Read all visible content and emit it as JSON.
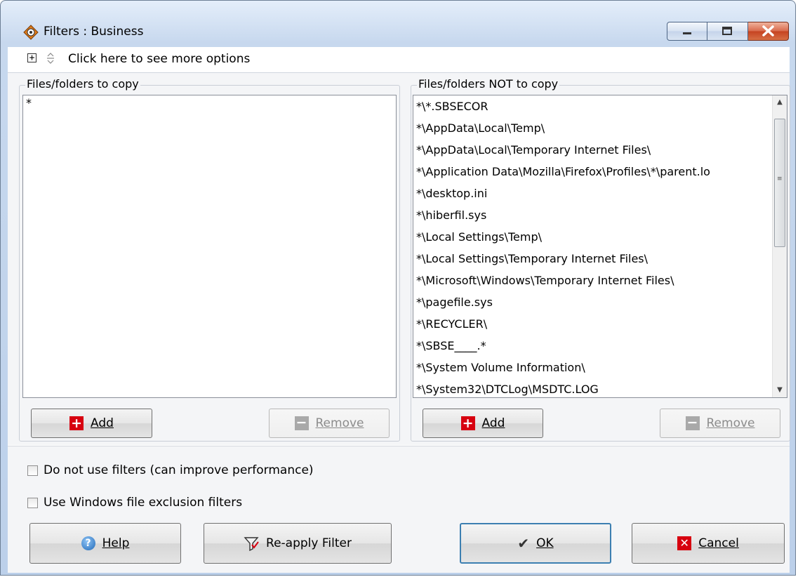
{
  "window": {
    "title": "Filters : Business"
  },
  "options_bar": {
    "label": "Click here to see more options"
  },
  "include_panel": {
    "title": "Files/folders to copy",
    "items": [
      "*"
    ],
    "add_label": "Add",
    "remove_label": "Remove"
  },
  "exclude_panel": {
    "title": "Files/folders NOT to copy",
    "items": [
      "*\\*.SBSECOR",
      "*\\AppData\\Local\\Temp\\",
      "*\\AppData\\Local\\Temporary Internet Files\\",
      "*\\Application Data\\Mozilla\\Firefox\\Profiles\\*\\parent.lo",
      "*\\desktop.ini",
      "*\\hiberfil.sys",
      "*\\Local Settings\\Temp\\",
      "*\\Local Settings\\Temporary Internet Files\\",
      "*\\Microsoft\\Windows\\Temporary Internet Files\\",
      "*\\pagefile.sys",
      "*\\RECYCLER\\",
      "*\\SBSE____.*",
      "*\\System Volume Information\\",
      "*\\System32\\DTCLog\\MSDTC.LOG"
    ],
    "add_label": "Add",
    "remove_label": "Remove"
  },
  "options": {
    "no_filters_label": "Do not use filters (can improve performance)",
    "no_filters_checked": false,
    "windows_exclusion_label": "Use Windows file exclusion filters",
    "windows_exclusion_checked": false
  },
  "buttons": {
    "help": "Help",
    "reapply": "Re-apply Filter",
    "ok": "OK",
    "cancel": "Cancel"
  },
  "colors": {
    "add_icon": "#d7000f",
    "cancel_icon": "#d7000f",
    "help_icon": "#2069b8"
  }
}
